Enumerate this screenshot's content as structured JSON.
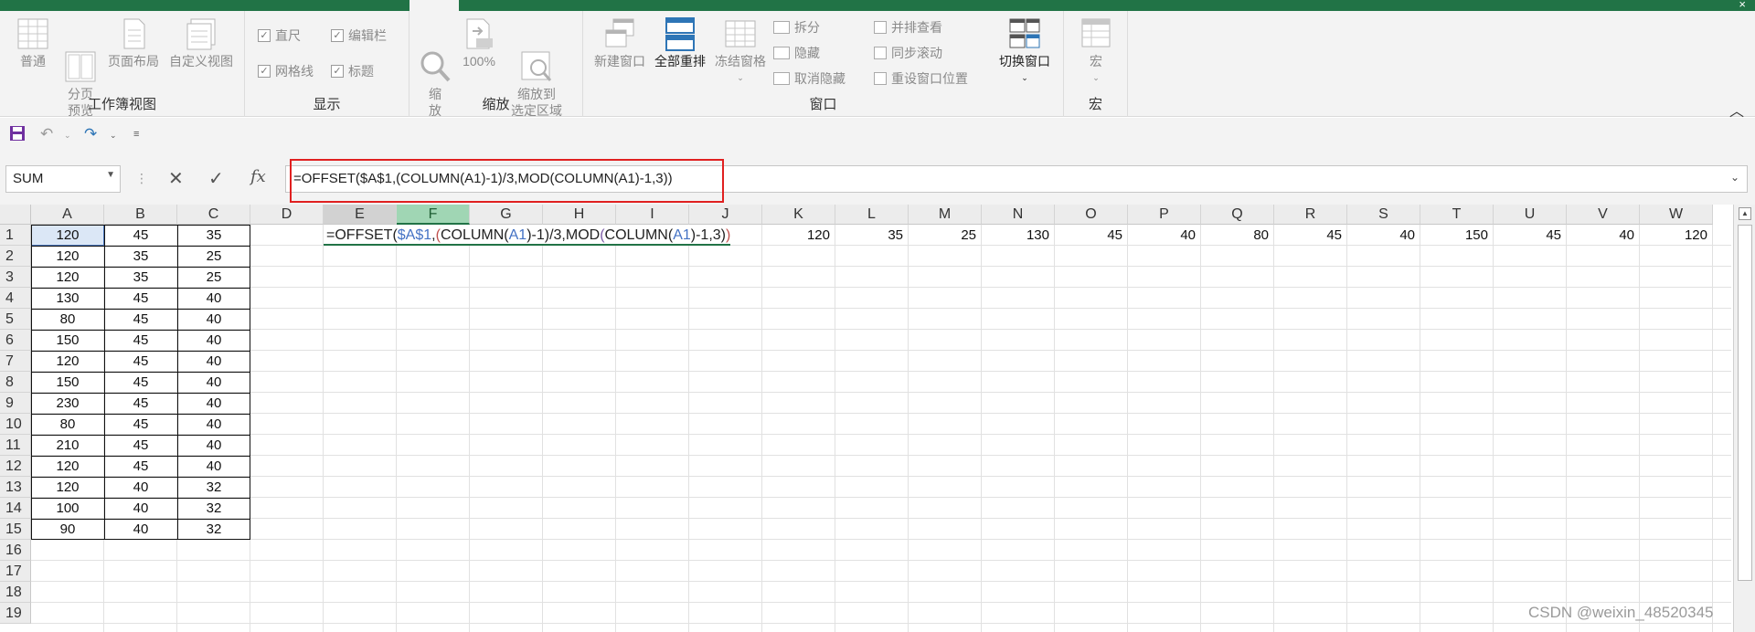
{
  "ribbon": {
    "groups": [
      {
        "label": "工作簿视图",
        "buttons": [
          "普通",
          "分页\n预览",
          "页面布局",
          "自定义视图"
        ]
      },
      {
        "label": "显示",
        "checks": [
          {
            "label": "直尺",
            "checked": true
          },
          {
            "label": "编辑栏",
            "checked": true
          },
          {
            "label": "网格线",
            "checked": true
          },
          {
            "label": "标题",
            "checked": true
          }
        ]
      },
      {
        "label": "缩放",
        "buttons": [
          "缩\n放",
          "100%",
          "缩放到\n选定区域"
        ]
      },
      {
        "label": "窗口",
        "buttons": [
          "新建窗口",
          "全部重排",
          "冻结窗格"
        ],
        "small": [
          "拆分",
          "隐藏",
          "取消隐藏",
          "并排查看",
          "同步滚动",
          "重设窗口位置"
        ],
        "switch": "切换窗口"
      },
      {
        "label": "宏",
        "buttons": [
          "宏"
        ]
      }
    ]
  },
  "namebox": {
    "value": "SUM"
  },
  "formula_bar": {
    "fx": "fx",
    "content": "=OFFSET($A$1,(COLUMN(A1)-1)/3,MOD(COLUMN(A1)-1,3))"
  },
  "edit_cell": {
    "p1": "=OFFSET(",
    "p2": "$A$1",
    "p3": ",",
    "p4": "(",
    "p5": "COLUMN(",
    "p6": "A1",
    "p7": ")-1)/3,MOD",
    "p8": "(",
    "p9": "COLUMN(",
    "p10": "A1",
    "p11": ")-1,3)",
    "p12": ")"
  },
  "columns": [
    "A",
    "B",
    "C",
    "D",
    "E",
    "F",
    "G",
    "H",
    "I",
    "J",
    "K",
    "L",
    "M",
    "N",
    "O",
    "P",
    "Q",
    "R",
    "S",
    "T",
    "U",
    "V",
    "W"
  ],
  "rows": [
    "1",
    "2",
    "3",
    "4",
    "5",
    "6",
    "7",
    "8",
    "9",
    "10",
    "11",
    "12",
    "13",
    "14",
    "15",
    "16",
    "17",
    "18",
    "19"
  ],
  "table": [
    [
      "120",
      "45",
      "35"
    ],
    [
      "120",
      "35",
      "25"
    ],
    [
      "120",
      "35",
      "25"
    ],
    [
      "130",
      "45",
      "40"
    ],
    [
      "80",
      "45",
      "40"
    ],
    [
      "150",
      "45",
      "40"
    ],
    [
      "120",
      "45",
      "40"
    ],
    [
      "150",
      "45",
      "40"
    ],
    [
      "230",
      "45",
      "40"
    ],
    [
      "80",
      "45",
      "40"
    ],
    [
      "210",
      "45",
      "40"
    ],
    [
      "120",
      "45",
      "40"
    ],
    [
      "120",
      "40",
      "32"
    ],
    [
      "100",
      "40",
      "32"
    ],
    [
      "90",
      "40",
      "32"
    ]
  ],
  "row1_results": [
    {
      "col": "K",
      "value": "120"
    },
    {
      "col": "L",
      "value": "35"
    },
    {
      "col": "M",
      "value": "25"
    },
    {
      "col": "N",
      "value": "130"
    },
    {
      "col": "O",
      "value": "45"
    },
    {
      "col": "P",
      "value": "40"
    },
    {
      "col": "Q",
      "value": "80"
    },
    {
      "col": "R",
      "value": "45"
    },
    {
      "col": "S",
      "value": "40"
    },
    {
      "col": "T",
      "value": "150"
    },
    {
      "col": "U",
      "value": "45"
    },
    {
      "col": "V",
      "value": "40"
    },
    {
      "col": "W",
      "value": "120"
    }
  ],
  "watermark": "CSDN @weixin_48520345"
}
